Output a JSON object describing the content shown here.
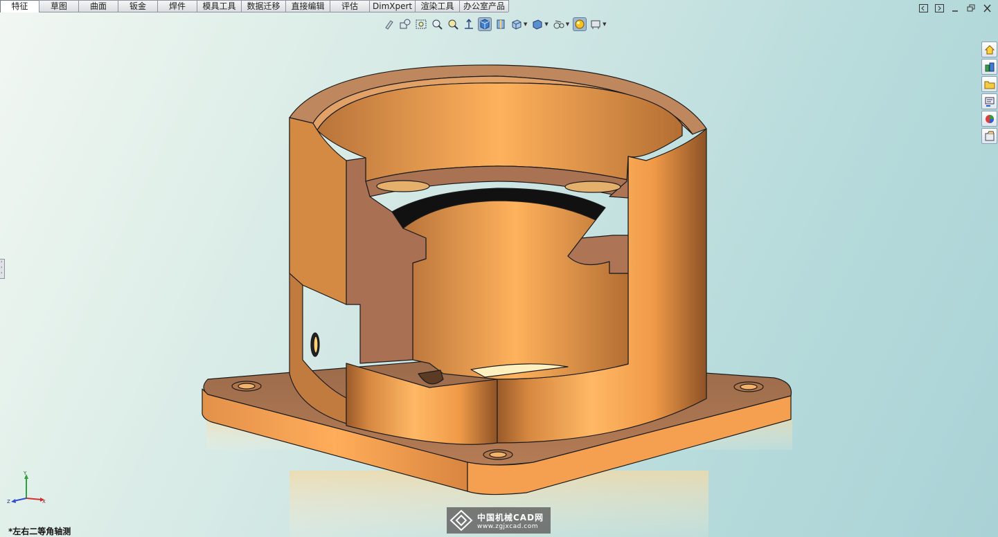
{
  "command_tabs": [
    {
      "label": "特征",
      "active": true
    },
    {
      "label": "草图",
      "active": false
    },
    {
      "label": "曲面",
      "active": false
    },
    {
      "label": "钣金",
      "active": false
    },
    {
      "label": "焊件",
      "active": false
    },
    {
      "label": "模具工具",
      "active": false
    },
    {
      "label": "数据迁移",
      "active": false
    },
    {
      "label": "直接编辑",
      "active": false
    },
    {
      "label": "评估",
      "active": false
    },
    {
      "label": "DimXpert",
      "active": false
    },
    {
      "label": "渲染工具",
      "active": false
    },
    {
      "label": "办公室产品",
      "active": false
    }
  ],
  "view_toolbar": {
    "icons": [
      "previous-view-icon",
      "zoom-to-fit-icon",
      "zoom-to-area-icon",
      "zoom-in-out-icon",
      "zoom-to-selection-icon",
      "rotate-view-icon",
      "shaded-with-edges-icon",
      "section-view-icon",
      "view-orientation-icon",
      "display-style-icon",
      "hide-show-items-icon",
      "appearance-icon",
      "scene-icon"
    ]
  },
  "window_controls": [
    "tile-left",
    "tile-right",
    "minimize",
    "restore",
    "close"
  ],
  "task_pane": [
    "solidworks-resources-icon",
    "design-library-icon",
    "file-explorer-icon",
    "view-palette-icon",
    "appearances-scenes-icon",
    "custom-properties-icon"
  ],
  "triad": {
    "x": "X",
    "y": "Y",
    "z": "Z"
  },
  "view_name": "*左右二等角轴测",
  "watermark": {
    "name": "中国机械CAD网",
    "url": "www.zgjxcad.com"
  },
  "colors": {
    "part": "#f0a050",
    "part_light": "#ffc27a",
    "part_dark": "#a8622a",
    "background_start": "#f2f7f3",
    "background_end": "#a9d2d6"
  }
}
